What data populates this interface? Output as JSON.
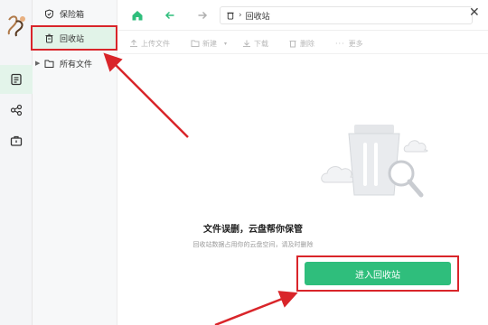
{
  "sidebar": {
    "items": [
      {
        "label": "保险箱",
        "icon": "shield-check-icon"
      },
      {
        "label": "回收站",
        "icon": "trash-icon",
        "active": true
      },
      {
        "label": "所有文件",
        "icon": "folder-icon"
      }
    ]
  },
  "rail": {
    "items": [
      {
        "icon": "notes-icon",
        "active": true
      },
      {
        "icon": "share-icon"
      },
      {
        "icon": "briefcase-icon"
      }
    ]
  },
  "address_bar": {
    "segment": "回收站"
  },
  "toolbar": {
    "upload_label": "上传文件",
    "new_label": "新建",
    "download_label": "下载",
    "delete_label": "删除",
    "more_label": "更多"
  },
  "empty_state": {
    "title": "文件误删，云盘帮你保管",
    "subtitle": "回收站数据占用你的云盘空间，请及时删除",
    "button_label": "进入回收站"
  },
  "colors": {
    "accent": "#2fbe7c",
    "highlight": "#d9252a"
  }
}
